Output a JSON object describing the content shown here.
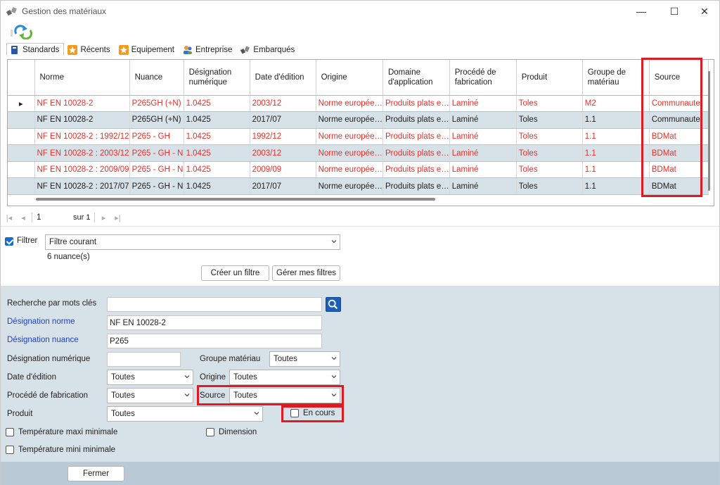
{
  "window": {
    "title": "Gestion des matériaux",
    "minimize_glyph": "—",
    "maximize_glyph": "☐",
    "close_glyph": "✕"
  },
  "tabs": [
    {
      "label": "Standards",
      "icon": "book-icon",
      "active": true
    },
    {
      "label": "Récents",
      "icon": "star-icon",
      "active": false
    },
    {
      "label": "Equipement",
      "icon": "star-icon",
      "active": false
    },
    {
      "label": "Entreprise",
      "icon": "people-icon",
      "active": false
    },
    {
      "label": "Embarqués",
      "icon": "tools-icon",
      "active": false
    }
  ],
  "grid": {
    "columns": [
      "Norme",
      "Nuance",
      "Désignation numérique",
      "Date d'édition",
      "Origine",
      "Domaine d'application",
      "Procédé de fabrication",
      "Produit",
      "Groupe de matériau",
      "Source"
    ],
    "row_indicator": "▸",
    "rows": [
      {
        "cells": [
          "NF EN 10028-2",
          "P265GH (+N)",
          "1.0425",
          "2003/12",
          "Norme europée…",
          "Produits plats e…",
          "Laminé",
          "Toles",
          "M2",
          "Communaute"
        ],
        "red": true,
        "alt": false,
        "current": true
      },
      {
        "cells": [
          "NF EN 10028-2",
          "P265GH (+N)",
          "1.0425",
          "2017/07",
          "Norme europée…",
          "Produits plats e…",
          "Laminé",
          "Toles",
          "1.1",
          "Communaute"
        ],
        "red": false,
        "alt": true,
        "current": false
      },
      {
        "cells": [
          "NF EN 10028-2 : 1992/12",
          "P265 - GH",
          "1.0425",
          "1992/12",
          "Norme europée…",
          "Produits plats e…",
          "Laminé",
          "Toles",
          "1.1",
          "BDMat"
        ],
        "red": true,
        "alt": false,
        "current": false
      },
      {
        "cells": [
          "NF EN 10028-2 : 2003/12",
          "P265 - GH - N",
          "1.0425",
          "2003/12",
          "Norme europée…",
          "Produits plats e…",
          "Laminé",
          "Toles",
          "1.1",
          "BDMat"
        ],
        "red": true,
        "alt": true,
        "current": false
      },
      {
        "cells": [
          "NF EN 10028-2 : 2009/09",
          "P265 - GH - N",
          "1.0425",
          "2009/09",
          "Norme europée…",
          "Produits plats e…",
          "Laminé",
          "Toles",
          "1.1",
          "BDMat"
        ],
        "red": true,
        "alt": false,
        "current": false
      },
      {
        "cells": [
          "NF EN 10028-2 : 2017/07",
          "P265 - GH - N",
          "1.0425",
          "2017/07",
          "Norme europée…",
          "Produits plats e…",
          "Laminé",
          "Toles",
          "1.1",
          "BDMat"
        ],
        "red": false,
        "alt": true,
        "current": false
      }
    ]
  },
  "pager": {
    "first": "|◂",
    "prev": "◂",
    "page": "1",
    "of_label": "sur 1",
    "next": "▸",
    "last": "▸|"
  },
  "filter": {
    "checkbox_label": "Filtrer",
    "checked": true,
    "current_filter": "Filtre courant",
    "count_text": "6 nuance(s)",
    "create_button": "Créer un filtre",
    "manage_button": "Gérer mes filtres"
  },
  "search": {
    "keywords_label": "Recherche par mots clés",
    "keywords_value": "",
    "norm_label": "Désignation norme",
    "norm_value": "NF EN 10028-2",
    "grade_label": "Désignation nuance",
    "grade_value": "P265",
    "numeric_label": "Désignation numérique",
    "numeric_value": "",
    "group_label": "Groupe matériau",
    "group_value": "Toutes",
    "date_label": "Date d'édition",
    "date_value": "Toutes",
    "origin_label": "Origine",
    "origin_value": "Toutes",
    "process_label": "Procédé de fabrication",
    "process_value": "Toutes",
    "source_label": "Source",
    "source_value": "Toutes",
    "product_label": "Produit",
    "product_value": "Toutes",
    "in_progress_label": "En cours",
    "temp_max_label": "Température maxi minimale",
    "temp_min_label": "Température mini minimale",
    "dimension_label": "Dimension"
  },
  "footer": {
    "close_button": "Fermer"
  },
  "colors": {
    "highlight_red": "#e01a22",
    "row_red_text": "#e8302a",
    "alt_row": "#d7e1e8",
    "link_blue": "#1f3fcf"
  }
}
